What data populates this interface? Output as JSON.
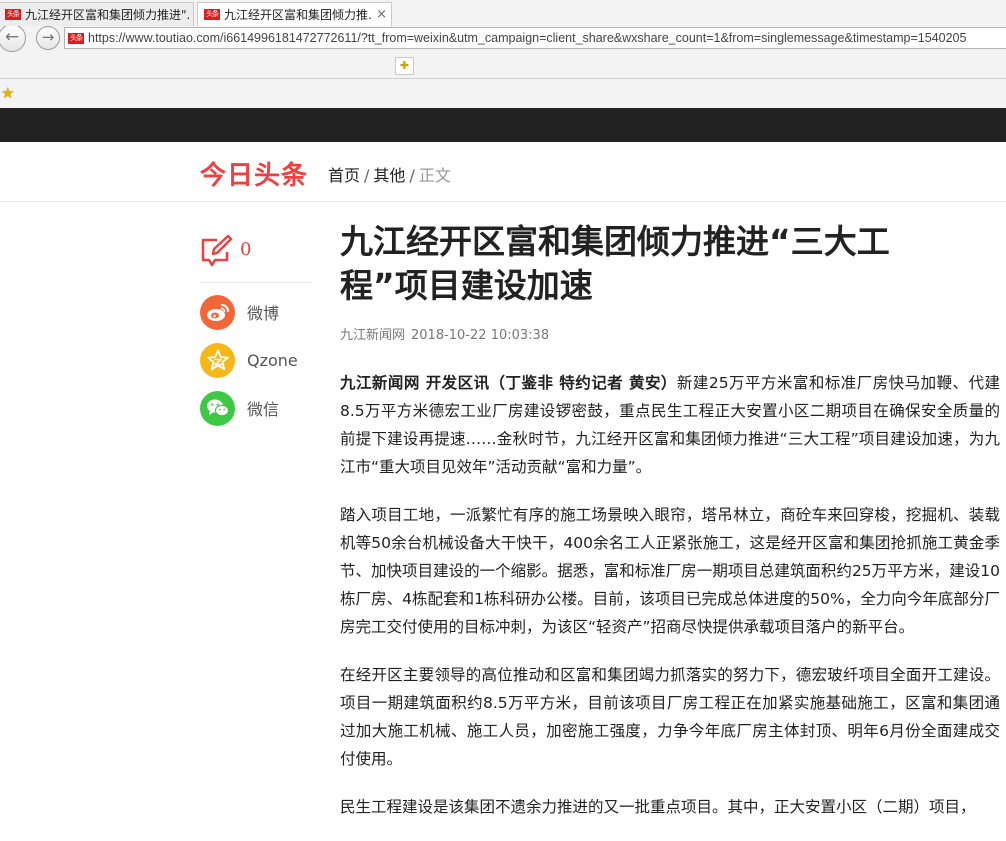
{
  "browser": {
    "address": "https://www.toutiao.com/i6614996181472772611/?tt_from=weixin&utm_campaign=client_share&wxshare_count=1&from=singlemessage&timestamp=1540205",
    "site_icon_text": "头条",
    "tabs": [
      {
        "label": "九江经开区富和集团倾力推进\"..."
      },
      {
        "label": "九江经开区富和集团倾力推...",
        "close": "×"
      }
    ],
    "back_glyph": "←",
    "forward_glyph": "→",
    "newtab_glyph": "✚",
    "favorites_glyph": "★"
  },
  "header": {
    "logo": "今日头条",
    "breadcrumb": {
      "home": "首页",
      "other": "其他",
      "current": "正文",
      "separator": "/"
    }
  },
  "share": {
    "comment_count": "0",
    "items": [
      {
        "label": "微博",
        "icon": "weibo-icon",
        "color": "#f2673a"
      },
      {
        "label": "Qzone",
        "icon": "qzone-icon",
        "color": "#f6b819"
      },
      {
        "label": "微信",
        "icon": "wechat-icon",
        "color": "#3fc846"
      }
    ]
  },
  "article": {
    "title": "九江经开区富和集团倾力推进“三大工程”项目建设加速",
    "source": "九江新闻网",
    "time": "2018-10-22 10:03:38",
    "paragraphs": [
      {
        "lead": "九江新闻网 开发区讯（丁鉴非 特约记者 黄安）",
        "text": "新建25万平方米富和标准厂房快马加鞭、代建8.5万平方米德宏工业厂房建设锣密鼓，重点民生工程正大安置小区二期项目在确保安全质量的前提下建设再提速……金秋时节，九江经开区富和集团倾力推进“三大工程”项目建设加速，为九江市“重大项目见效年”活动贡献“富和力量”。"
      },
      {
        "text": "踏入项目工地，一派繁忙有序的施工场景映入眼帘，塔吊林立，商砼车来回穿梭，挖掘机、装载机等50余台机械设备大干快干，400余名工人正紧张施工，这是经开区富和集团抢抓施工黄金季节、加快项目建设的一个缩影。据悉，富和标准厂房一期项目总建筑面积约25万平方米，建设10栋厂房、4栋配套和1栋科研办公楼。目前，该项目已完成总体进度的50%，全力向今年底部分厂房完工交付使用的目标冲刺，为该区“轻资产”招商尽快提供承载项目落户的新平台。"
      },
      {
        "text": "在经开区主要领导的高位推动和区富和集团竭力抓落实的努力下，德宏玻纤项目全面开工建设。项目一期建筑面积约8.5万平方米，目前该项目厂房工程正在加紧实施基础施工，区富和集团通过加大施工机械、施工人员，加密施工强度，力争今年底厂房主体封顶、明年6月份全面建成交付使用。"
      },
      {
        "text": "民生工程建设是该集团不遗余力推进的又一批重点项目。其中，正大安置小区（二期）项目，"
      }
    ]
  }
}
